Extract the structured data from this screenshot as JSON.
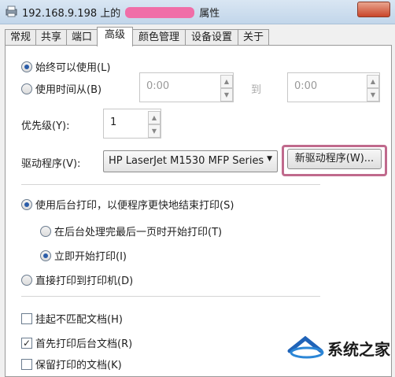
{
  "window": {
    "title_prefix": "192.168.9.198 上的",
    "title_suffix": "属性"
  },
  "tabs": [
    "常规",
    "共享",
    "端口",
    "高级",
    "颜色管理",
    "设备设置",
    "关于"
  ],
  "active_tab": "高级",
  "availability": {
    "always_label": "始终可以使用(L)",
    "time_from_label": "使用时间从(B)",
    "from_value": "0:00",
    "to_label": "到",
    "to_value": "0:00",
    "selected": "always"
  },
  "priority": {
    "label": "优先级(Y):",
    "value": "1"
  },
  "driver": {
    "label": "驱动程序(V):",
    "selected": "HP LaserJet M1530 MFP Series",
    "new_driver_button": "新驱动程序(W)..."
  },
  "spooling": {
    "spool_label": "使用后台打印，以便程序更快地结束打印(S)",
    "after_last_page_label": "在后台处理完最后一页时开始打印(T)",
    "immediately_label": "立即开始打印(I)",
    "direct_label": "直接打印到打印机(D)"
  },
  "options": {
    "hold_mismatched": {
      "label": "挂起不匹配文档(H)",
      "checked": false
    },
    "print_spooled_first": {
      "label": "首先打印后台文档(R)",
      "checked": true
    },
    "keep_printed": {
      "label": "保留打印的文档(K)",
      "checked": false
    }
  },
  "watermark": {
    "text": "系统之家"
  }
}
